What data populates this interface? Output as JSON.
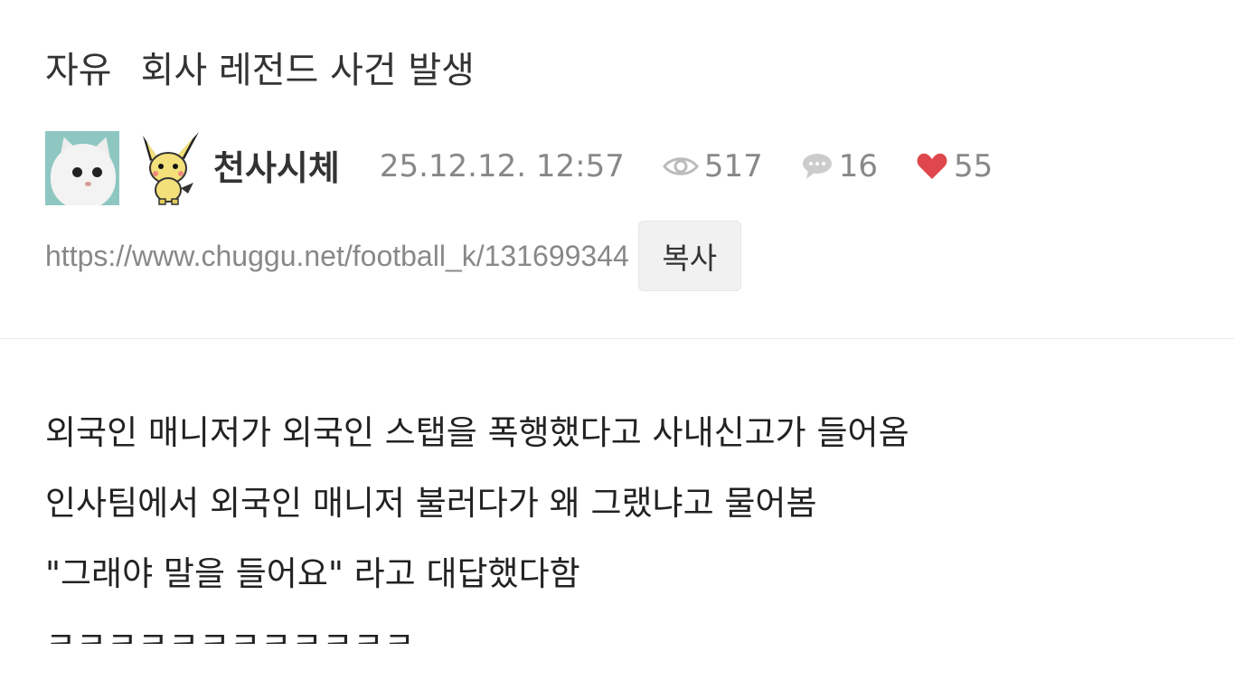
{
  "post": {
    "category": "자유",
    "title": "회사 레전드 사건 발생",
    "author": "천사시체",
    "date": "25.12.12. 12:57",
    "views": "517",
    "comments": "16",
    "likes": "55",
    "url": "https://www.chuggu.net/football_k/131699344",
    "copy_label": "복사"
  },
  "body": {
    "lines": [
      "외국인 매니저가 외국인 스탭을 폭행했다고 사내신고가 들어옴",
      "인사팀에서 외국인 매니저 불러다가 왜 그랬냐고 물어봄",
      "\"그래야 말을 들어요\" 라고 대답했다함",
      "ㅋㅋㅋㅋㅋㅋㅋㅋㅋㅋㅋㅋ"
    ]
  },
  "icons": {
    "views": "eye-icon",
    "comments": "speech-bubble-icon",
    "likes": "heart-icon"
  },
  "colors": {
    "heart": "#e0474c",
    "meta_gray": "#888888",
    "copy_button_bg": "#f1f1f1"
  }
}
